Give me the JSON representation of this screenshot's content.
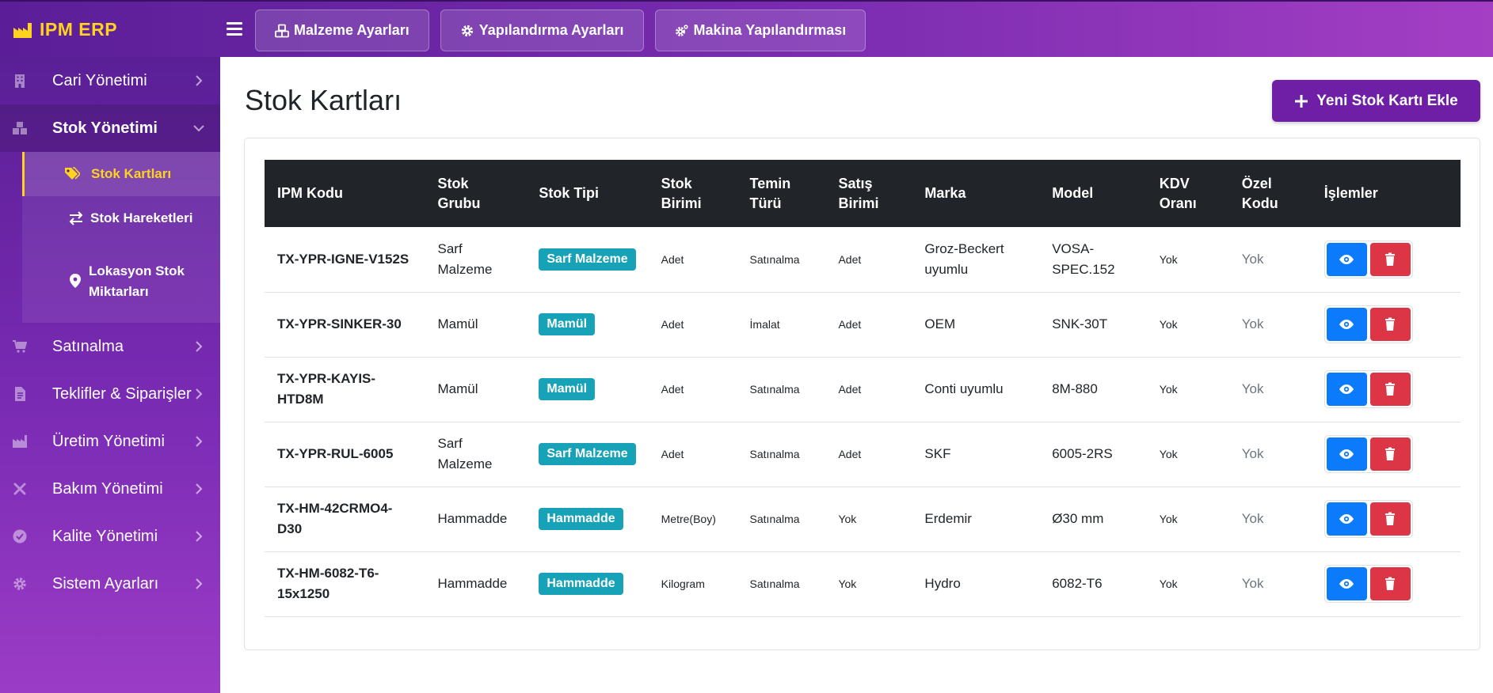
{
  "brand": {
    "name": "IPM ERP",
    "color": "#ffd21f"
  },
  "topnav": [
    {
      "label": "Malzeme Ayarları",
      "icon": "cubes-icon"
    },
    {
      "label": "Yapılandırma Ayarları",
      "icon": "gear-icon"
    },
    {
      "label": "Makina Yapılandırması",
      "icon": "gears-icon"
    }
  ],
  "sidebar": {
    "items": [
      {
        "label": "Cari Yönetimi",
        "icon": "building-icon"
      },
      {
        "label": "Stok Yönetimi",
        "icon": "boxes-icon"
      },
      {
        "label": "Satınalma",
        "icon": "cart-icon"
      },
      {
        "label": "Teklifler & Siparişler",
        "icon": "invoice-icon"
      },
      {
        "label": "Üretim Yönetimi",
        "icon": "factory-icon"
      },
      {
        "label": "Bakım Yönetimi",
        "icon": "tools-icon"
      },
      {
        "label": "Kalite Yönetimi",
        "icon": "check-circle-icon"
      },
      {
        "label": "Sistem Ayarları",
        "icon": "cog-icon"
      }
    ],
    "submenu": [
      {
        "label": "Stok Kartları",
        "icon": "tags-icon",
        "active": true
      },
      {
        "label": "Stok Hareketleri",
        "icon": "exchange-icon"
      },
      {
        "label": "Lokasyon Stok Miktarları",
        "icon": "map-marker-icon"
      }
    ]
  },
  "page": {
    "title": "Stok Kartları",
    "add_button": "Yeni Stok Kartı Ekle"
  },
  "table": {
    "headers": {
      "code": "IPM Kodu",
      "group": "Stok Grubu",
      "type": "Stok Tipi",
      "unit": "Stok Birimi",
      "supply": "Temin Türü",
      "sales_unit": "Satış Birimi",
      "brand": "Marka",
      "model": "Model",
      "vat": "KDV Oranı",
      "special": "Özel Kodu",
      "actions": "İşlemler"
    },
    "rows": [
      {
        "code": "TX-YPR-IGNE-V152S",
        "group": "Sarf Malzeme",
        "type": "Sarf Malzeme",
        "unit": "Adet",
        "supply": "Satınalma",
        "sales_unit": "Adet",
        "brand": "Groz-Beckert uyumlu",
        "model": "VOSA-SPEC.152",
        "vat": "Yok",
        "special": "Yok"
      },
      {
        "code": "TX-YPR-SINKER-30",
        "group": "Mamül",
        "type": "Mamül",
        "unit": "Adet",
        "supply": "İmalat",
        "sales_unit": "Adet",
        "brand": "OEM",
        "model": "SNK-30T",
        "vat": "Yok",
        "special": "Yok"
      },
      {
        "code": "TX-YPR-KAYIS-HTD8M",
        "group": "Mamül",
        "type": "Mamül",
        "unit": "Adet",
        "supply": "Satınalma",
        "sales_unit": "Adet",
        "brand": "Conti uyumlu",
        "model": "8M-880",
        "vat": "Yok",
        "special": "Yok"
      },
      {
        "code": "TX-YPR-RUL-6005",
        "group": "Sarf Malzeme",
        "type": "Sarf Malzeme",
        "unit": "Adet",
        "supply": "Satınalma",
        "sales_unit": "Adet",
        "brand": "SKF",
        "model": "6005-2RS",
        "vat": "Yok",
        "special": "Yok"
      },
      {
        "code": "TX-HM-42CRMO4-D30",
        "group": "Hammadde",
        "type": "Hammadde",
        "unit": "Metre(Boy)",
        "supply": "Satınalma",
        "sales_unit": "Yok",
        "brand": "Erdemir",
        "model": "Ø30 mm",
        "vat": "Yok",
        "special": "Yok"
      },
      {
        "code": "TX-HM-6082-T6-15x1250",
        "group": "Hammadde",
        "type": "Hammadde",
        "unit": "Kilogram",
        "supply": "Satınalma",
        "sales_unit": "Yok",
        "brand": "Hydro",
        "model": "6082-T6",
        "vat": "Yok",
        "special": "Yok"
      }
    ]
  },
  "colors": {
    "accent": "#6f1fa6",
    "badge": "#17a2b8",
    "view": "#0b7bfb",
    "delete": "#dc3545",
    "table_header": "#212529"
  }
}
